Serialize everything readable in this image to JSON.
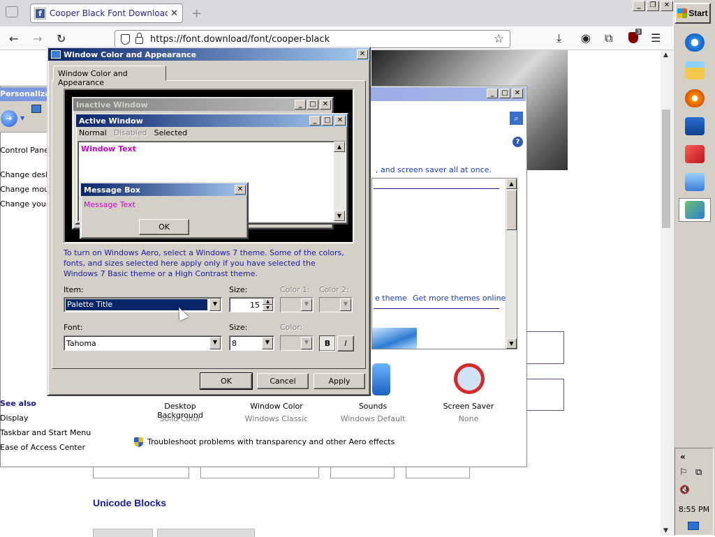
{
  "browser": {
    "tab_title": "Cooper Black Font Download | Free",
    "tab_favicon": "f",
    "url": "https://font.download/font/cooper-black",
    "badge_count": "3"
  },
  "page": {
    "unicode_heading": "Unicode Blocks"
  },
  "personalization": {
    "title": "Personalization",
    "nav_label": "Control Panel H",
    "left_links": [
      "Change deskto",
      "Change mouse",
      "Change your a"
    ],
    "see_also_heading": "See also",
    "see_also_links": [
      "Display",
      "Taskbar and Start Menu",
      "Ease of Access Center"
    ],
    "intro_text": ", and screen saver all at once.",
    "theme_link": "e theme",
    "more_themes_link": "Get more themes online",
    "items": [
      {
        "label": "Desktop Background",
        "sub": "Solid Color"
      },
      {
        "label": "Window Color",
        "sub": "Windows Classic"
      },
      {
        "label": "Sounds",
        "sub": "Windows Default"
      },
      {
        "label": "Screen Saver",
        "sub": "None"
      }
    ],
    "troubleshoot_link": "Troubleshoot problems with transparency and other Aero effects"
  },
  "dialog": {
    "title": "Window Color and Appearance",
    "tab": "Window Color and Appearance",
    "preview": {
      "inactive_title": "Inactive Window",
      "active_title": "Active Window",
      "menu": [
        "Normal",
        "Disabled",
        "Selected"
      ],
      "window_text": "Window Text",
      "msgbox_title": "Message Box",
      "msgbox_text": "Message Text",
      "msgbox_ok": "OK"
    },
    "info_text": "To turn on Windows Aero, select a Windows 7 theme.  Some of the colors, fonts, and sizes selected here apply only if you have selected the Windows 7 Basic theme or a High Contrast theme.",
    "item_label": "Item:",
    "item_value": "Palette Title",
    "size_label": "Size:",
    "size_value": "15",
    "color1_label": "Color 1:",
    "color2_label": "Color 2:",
    "font_label": "Font:",
    "font_value": "Tahoma",
    "font_size_label": "Size:",
    "font_size_value": "8",
    "font_color_label": "Color:",
    "bold_label": "B",
    "italic_label": "I",
    "ok": "OK",
    "cancel": "Cancel",
    "apply": "Apply"
  },
  "taskbar": {
    "start_label": "Start",
    "clock": "8:55 PM",
    "tray_expand": "«"
  },
  "colors": {
    "title_active_start": "#0a246a",
    "title_active_end": "#a6caf0",
    "classic_face": "#d4d0c8",
    "link_blue": "#1a3dc1",
    "window_text": "#cc00cc"
  }
}
